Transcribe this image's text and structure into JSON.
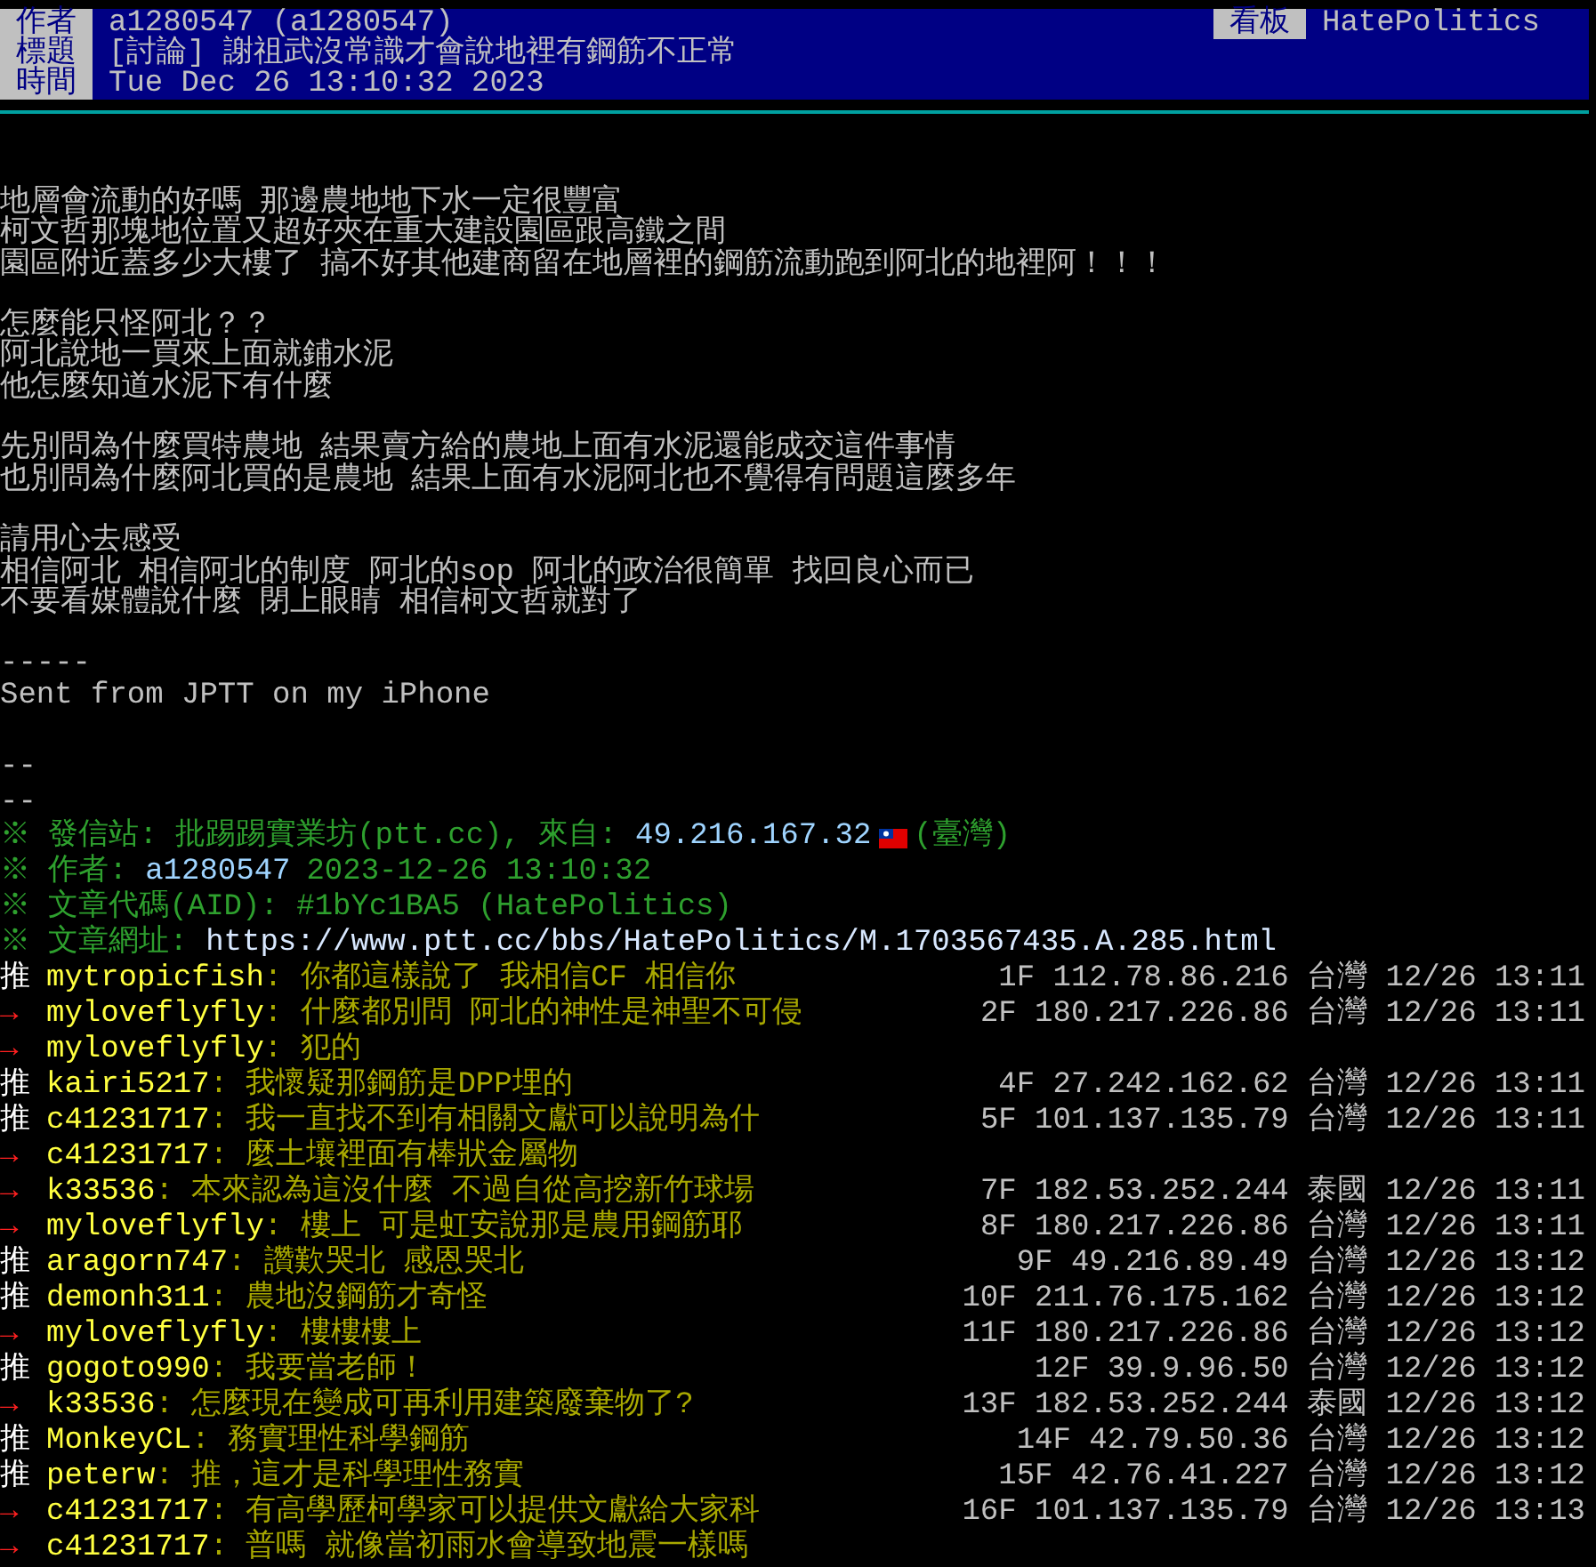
{
  "header": {
    "rows": [
      {
        "label": "作者",
        "value": "a1280547 (a1280547)",
        "side_label": "看板",
        "side_value": "HatePolitics"
      },
      {
        "label": "標題",
        "value": "[討論] 謝祖武沒常識才會說地裡有鋼筋不正常"
      },
      {
        "label": "時間",
        "value": "Tue Dec 26 13:10:32 2023"
      }
    ]
  },
  "body": {
    "paragraphs": [
      [
        "地層會流動的好嗎 那邊農地地下水一定很豐富",
        "柯文哲那塊地位置又超好夾在重大建設園區跟高鐵之間",
        "園區附近蓋多少大樓了 搞不好其他建商留在地層裡的鋼筋流動跑到阿北的地裡阿！！！"
      ],
      [
        "怎麼能只怪阿北？？",
        "阿北說地一買來上面就鋪水泥",
        "他怎麼知道水泥下有什麼"
      ],
      [
        "先別問為什麼買特農地 結果賣方給的農地上面有水泥還能成交這件事情",
        "也別問為什麼阿北買的是農地 結果上面有水泥阿北也不覺得有問題這麼多年"
      ],
      [
        "請用心去感受",
        "相信阿北 相信阿北的制度 阿北的sop 阿北的政治很簡單 找回良心而已",
        "不要看媒體說什麼 閉上眼睛 相信柯文哲就對了"
      ],
      [
        "-----",
        "Sent from JPTT on my iPhone"
      ]
    ]
  },
  "footer": {
    "dashes": [
      "--",
      "--"
    ],
    "info_lines": [
      {
        "segments": [
          {
            "kind": "label",
            "text": "※ 發信站: 批踢踢實業坊(ptt.cc), 來自: "
          },
          {
            "kind": "value",
            "text": "49.216.167.32"
          },
          {
            "kind": "flag"
          },
          {
            "kind": "label",
            "text": "(臺灣)"
          }
        ]
      },
      {
        "segments": [
          {
            "kind": "label",
            "text": "※ 作者: "
          },
          {
            "kind": "value",
            "text": "a1280547"
          },
          {
            "kind": "label",
            "text": "2023-12-26 13:10:32"
          }
        ]
      },
      {
        "segments": [
          {
            "kind": "label",
            "text": "※ 文章代碼(AID): #1bYc1BA5 (HatePolitics)"
          }
        ]
      },
      {
        "segments": [
          {
            "kind": "label",
            "text": "※ 文章網址: "
          },
          {
            "kind": "link",
            "text": "https://www.ptt.cc/bbs/HatePolitics/M.1703567435.A.285.html"
          }
        ]
      }
    ]
  },
  "comments": [
    {
      "kind": "push",
      "tag": "推",
      "user": "mytropicfish",
      "content": ": 你都這樣說了 我相信CF 相信你",
      "meta": "1F 112.78.86.216 台灣 12/26 13:11"
    },
    {
      "kind": "arrow",
      "tag": "→",
      "user": "myloveflyfly",
      "content": ": 什麼都別問 阿北的神性是神聖不可侵",
      "meta": "2F 180.217.226.86 台灣 12/26 13:11"
    },
    {
      "kind": "arrow",
      "tag": "→",
      "user": "myloveflyfly",
      "content": ": 犯的"
    },
    {
      "kind": "push",
      "tag": "推",
      "user": "kairi5217",
      "content": ": 我懷疑那鋼筋是DPP埋的",
      "meta": "4F 27.242.162.62 台灣 12/26 13:11"
    },
    {
      "kind": "push",
      "tag": "推",
      "user": "c41231717",
      "content": ": 我一直找不到有相關文獻可以說明為什",
      "meta": "5F 101.137.135.79 台灣 12/26 13:11"
    },
    {
      "kind": "arrow",
      "tag": "→",
      "user": "c41231717",
      "content": ": 麼土壤裡面有棒狀金屬物"
    },
    {
      "kind": "arrow",
      "tag": "→",
      "user": "k33536",
      "content": ": 本來認為這沒什麼 不過自從高挖新竹球場",
      "meta": "7F 182.53.252.244 泰國 12/26 13:11"
    },
    {
      "kind": "arrow",
      "tag": "→",
      "user": "myloveflyfly",
      "content": ": 樓上 可是虹安說那是農用鋼筋耶",
      "meta": "8F 180.217.226.86 台灣 12/26 13:11"
    },
    {
      "kind": "push",
      "tag": "推",
      "user": "aragorn747",
      "content": ": 讚歎哭北 感恩哭北",
      "meta": "9F 49.216.89.49 台灣 12/26 13:12"
    },
    {
      "kind": "push",
      "tag": "推",
      "user": "demonh311",
      "content": ": 農地沒鋼筋才奇怪",
      "meta": "10F 211.76.175.162 台灣 12/26 13:12"
    },
    {
      "kind": "arrow",
      "tag": "→",
      "user": "myloveflyfly",
      "content": ": 樓樓樓上",
      "meta": "11F 180.217.226.86 台灣 12/26 13:12"
    },
    {
      "kind": "push",
      "tag": "推",
      "user": "gogoto990",
      "content": ": 我要當老師！",
      "meta": "12F 39.9.96.50 台灣 12/26 13:12"
    },
    {
      "kind": "arrow",
      "tag": "→",
      "user": "k33536",
      "content": ": 怎麼現在變成可再利用建築廢棄物了?",
      "meta": "13F 182.53.252.244 泰國 12/26 13:12"
    },
    {
      "kind": "push",
      "tag": "推",
      "user": "MonkeyCL",
      "content": ": 務實理性科學鋼筋",
      "meta": "14F 42.79.50.36 台灣 12/26 13:12"
    },
    {
      "kind": "push",
      "tag": "推",
      "user": "peterw",
      "content": ": 推，這才是科學理性務實",
      "meta": "15F 42.76.41.227 台灣 12/26 13:12"
    },
    {
      "kind": "arrow",
      "tag": "→",
      "user": "c41231717",
      "content": ": 有高學歷柯學家可以提供文獻給大家科",
      "meta": "16F 101.137.135.79 台灣 12/26 13:13"
    },
    {
      "kind": "arrow",
      "tag": "→",
      "user": "c41231717",
      "content": ": 普嗎 就像當初雨水會導致地震一樣嗎"
    }
  ]
}
